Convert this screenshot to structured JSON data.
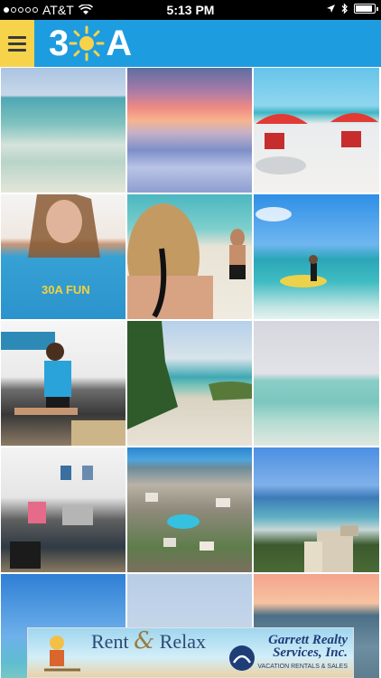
{
  "status_bar": {
    "carrier": "AT&T",
    "time": "5:13 PM",
    "battery_level": 0.9
  },
  "app_bar": {
    "logo_left": "3",
    "logo_right": "A",
    "menu_icon": "hamburger-icon"
  },
  "colors": {
    "app_bar": "#1d9ce0",
    "menu_button": "#f6d34b"
  },
  "gallery": {
    "photos": [
      "beach-waves",
      "sunset-shore",
      "red-umbrellas",
      "blue-shirt-model",
      "couple-beach",
      "paddleboarder",
      "jeep-model",
      "dune-path",
      "hazy-ocean",
      "print-shop",
      "resort-aerial",
      "boardwalk-ocean",
      "sky-sea-1",
      "sky-sea-2",
      "sunset-sea"
    ]
  },
  "ad_banner": {
    "headline_1": "Rent",
    "headline_amp": "&",
    "headline_2": "Relax",
    "brand_line_1": "Garrett Realty",
    "brand_line_2": "Services, Inc.",
    "brand_sub": "VACATION RENTALS & SALES"
  }
}
